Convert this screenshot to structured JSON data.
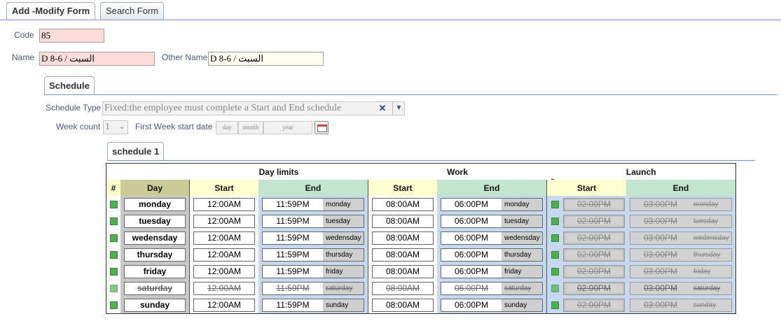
{
  "tabs": [
    "Add -Modify Form",
    "Search Form"
  ],
  "form": {
    "code_label": "Code",
    "code_value": "85",
    "name_label": "Name",
    "name_value": "D 8-6 / السبت",
    "other_name_label": "Other Name",
    "other_name_value": "D 8-6 / السبت"
  },
  "schedule_tab": "Schedule",
  "schedule_type": {
    "label": "Schedule Type",
    "value": "Fixed:the employee must complete a Start and End schedule"
  },
  "week_count": {
    "label": "Week count",
    "value": "1"
  },
  "first_week": {
    "label": "First Week start date",
    "day": "day",
    "month": "month",
    "year": "year"
  },
  "schedule_subtab": "schedule 1",
  "table": {
    "groups": [
      "Day limits",
      "Work",
      "Launch"
    ],
    "cols": {
      "num": "#",
      "day": "Day",
      "start": "Start",
      "end": "End"
    },
    "launch_mark": "˜",
    "rows": [
      {
        "day": "monday",
        "dl_start": "12:00AM",
        "dl_end": "11:59PM",
        "work_start": "08:00AM",
        "work_end": "06:00PM",
        "l_start": "02:00PM",
        "l_end": "03:00PM"
      },
      {
        "day": "tuesday",
        "dl_start": "12:00AM",
        "dl_end": "11:59PM",
        "work_start": "08:00AM",
        "work_end": "06:00PM",
        "l_start": "02:00PM",
        "l_end": "03:00PM"
      },
      {
        "day": "wedensday",
        "dl_start": "12:00AM",
        "dl_end": "11:59PM",
        "work_start": "08:00AM",
        "work_end": "06:00PM",
        "l_start": "02:00PM",
        "l_end": "03:00PM"
      },
      {
        "day": "thursday",
        "dl_start": "12:00AM",
        "dl_end": "11:59PM",
        "work_start": "08:00AM",
        "work_end": "06:00PM",
        "l_start": "02:00PM",
        "l_end": "03:00PM"
      },
      {
        "day": "friday",
        "dl_start": "12:00AM",
        "dl_end": "11:59PM",
        "work_start": "08:00AM",
        "work_end": "06:00PM",
        "l_start": "02:00PM",
        "l_end": "03:00PM"
      },
      {
        "day": "saturday",
        "dl_start": "12:00AM",
        "dl_end": "11:59PM",
        "work_start": "08:00AM",
        "work_end": "06:00PM",
        "l_start": "02:00PM",
        "l_end": "03:00PM",
        "disabled": true
      },
      {
        "day": "sunday",
        "dl_start": "12:00AM",
        "dl_end": "11:59PM",
        "work_start": "08:00AM",
        "work_end": "06:00PM",
        "l_start": "02:00PM",
        "l_end": "03:00PM"
      }
    ]
  },
  "colors": {
    "check": "#4caf50",
    "launch_blue": "#c6d9f1",
    "header_yellow": "#ffffd0",
    "header_green": "#c3e4cd"
  },
  "icons": {
    "clear": "x-icon",
    "dropdown": "chevron-down-icon",
    "calendar": "calendar-icon"
  }
}
